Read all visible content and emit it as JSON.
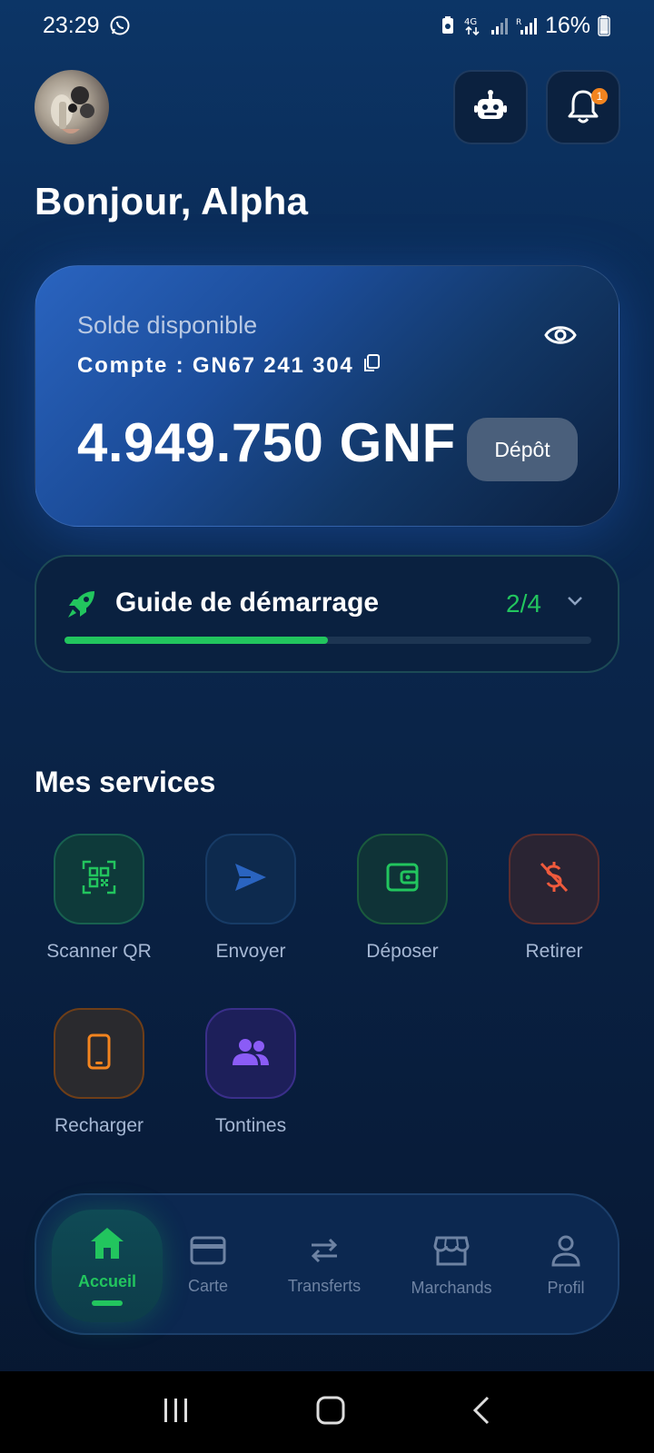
{
  "status_bar": {
    "time": "23:29",
    "battery": "16%"
  },
  "header": {
    "greeting": "Bonjour, Alpha",
    "notification_count": "1"
  },
  "balance": {
    "label": "Solde disponible",
    "account": "Compte : GN67 241 304",
    "amount": "4.949.750 GNF",
    "deposit_label": "Dépôt"
  },
  "guide": {
    "title": "Guide de démarrage",
    "progress_text": "2/4",
    "progress": 0.5
  },
  "services": {
    "title": "Mes services",
    "items": [
      {
        "label": "Scanner QR",
        "icon": "qr-icon"
      },
      {
        "label": "Envoyer",
        "icon": "send-icon"
      },
      {
        "label": "Déposer",
        "icon": "wallet-icon"
      },
      {
        "label": "Retirer",
        "icon": "no-dollar-icon"
      },
      {
        "label": "Recharger",
        "icon": "phone-icon"
      },
      {
        "label": "Tontines",
        "icon": "group-icon"
      }
    ]
  },
  "bottom_nav": {
    "items": [
      {
        "label": "Accueil",
        "icon": "home-icon",
        "active": true
      },
      {
        "label": "Carte",
        "icon": "card-icon"
      },
      {
        "label": "Transferts",
        "icon": "transfer-icon"
      },
      {
        "label": "Marchands",
        "icon": "store-icon"
      },
      {
        "label": "Profil",
        "icon": "person-icon"
      }
    ]
  },
  "colors": {
    "accent": "#22c55e",
    "badge": "#f2841f",
    "card_blue": "#2a64c0"
  }
}
